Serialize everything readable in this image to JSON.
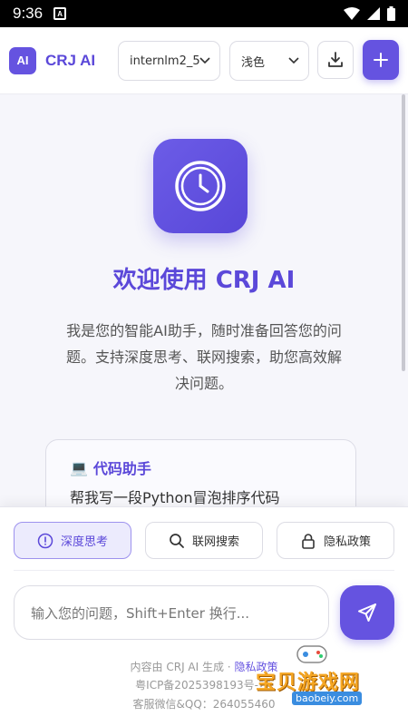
{
  "status_bar": {
    "time": "9:36",
    "app_indicator": "A"
  },
  "header": {
    "logo_text": "AI",
    "brand": "CRJ AI",
    "model_select": {
      "value": "internlm2_5"
    },
    "theme_select": {
      "value": "浅色"
    },
    "download_icon": "download-icon",
    "new_chat_icon": "plus-icon"
  },
  "main": {
    "hero_icon": "clock-icon",
    "welcome_title": "欢迎使用 CRJ AI",
    "intro_line1": "我是您的智能AI助手，随时准备回答您的问",
    "intro_line2": "题。支持深度思考、联网搜索，助您高效解",
    "intro_line3": "决问题。",
    "card": {
      "emoji": "💻",
      "title": "代码助手",
      "text": "帮我写一段Python冒泡排序代码"
    }
  },
  "tools": {
    "deep_think": "深度思考",
    "web_search": "联网搜索",
    "privacy": "隐私政策"
  },
  "input": {
    "placeholder": "输入您的问题，Shift+Enter 换行..."
  },
  "footer": {
    "generated_by": "内容由 CRJ AI 生成 · ",
    "privacy_link": "隐私政策",
    "icp": "粤ICP备2025398193号-2A",
    "contact": "客服微信&QQ：264055460"
  },
  "watermark": {
    "text": "宝贝游戏网",
    "url": "baobeiy.com"
  },
  "colors": {
    "accent": "#6553e0",
    "accent_light": "#ecebfd"
  }
}
